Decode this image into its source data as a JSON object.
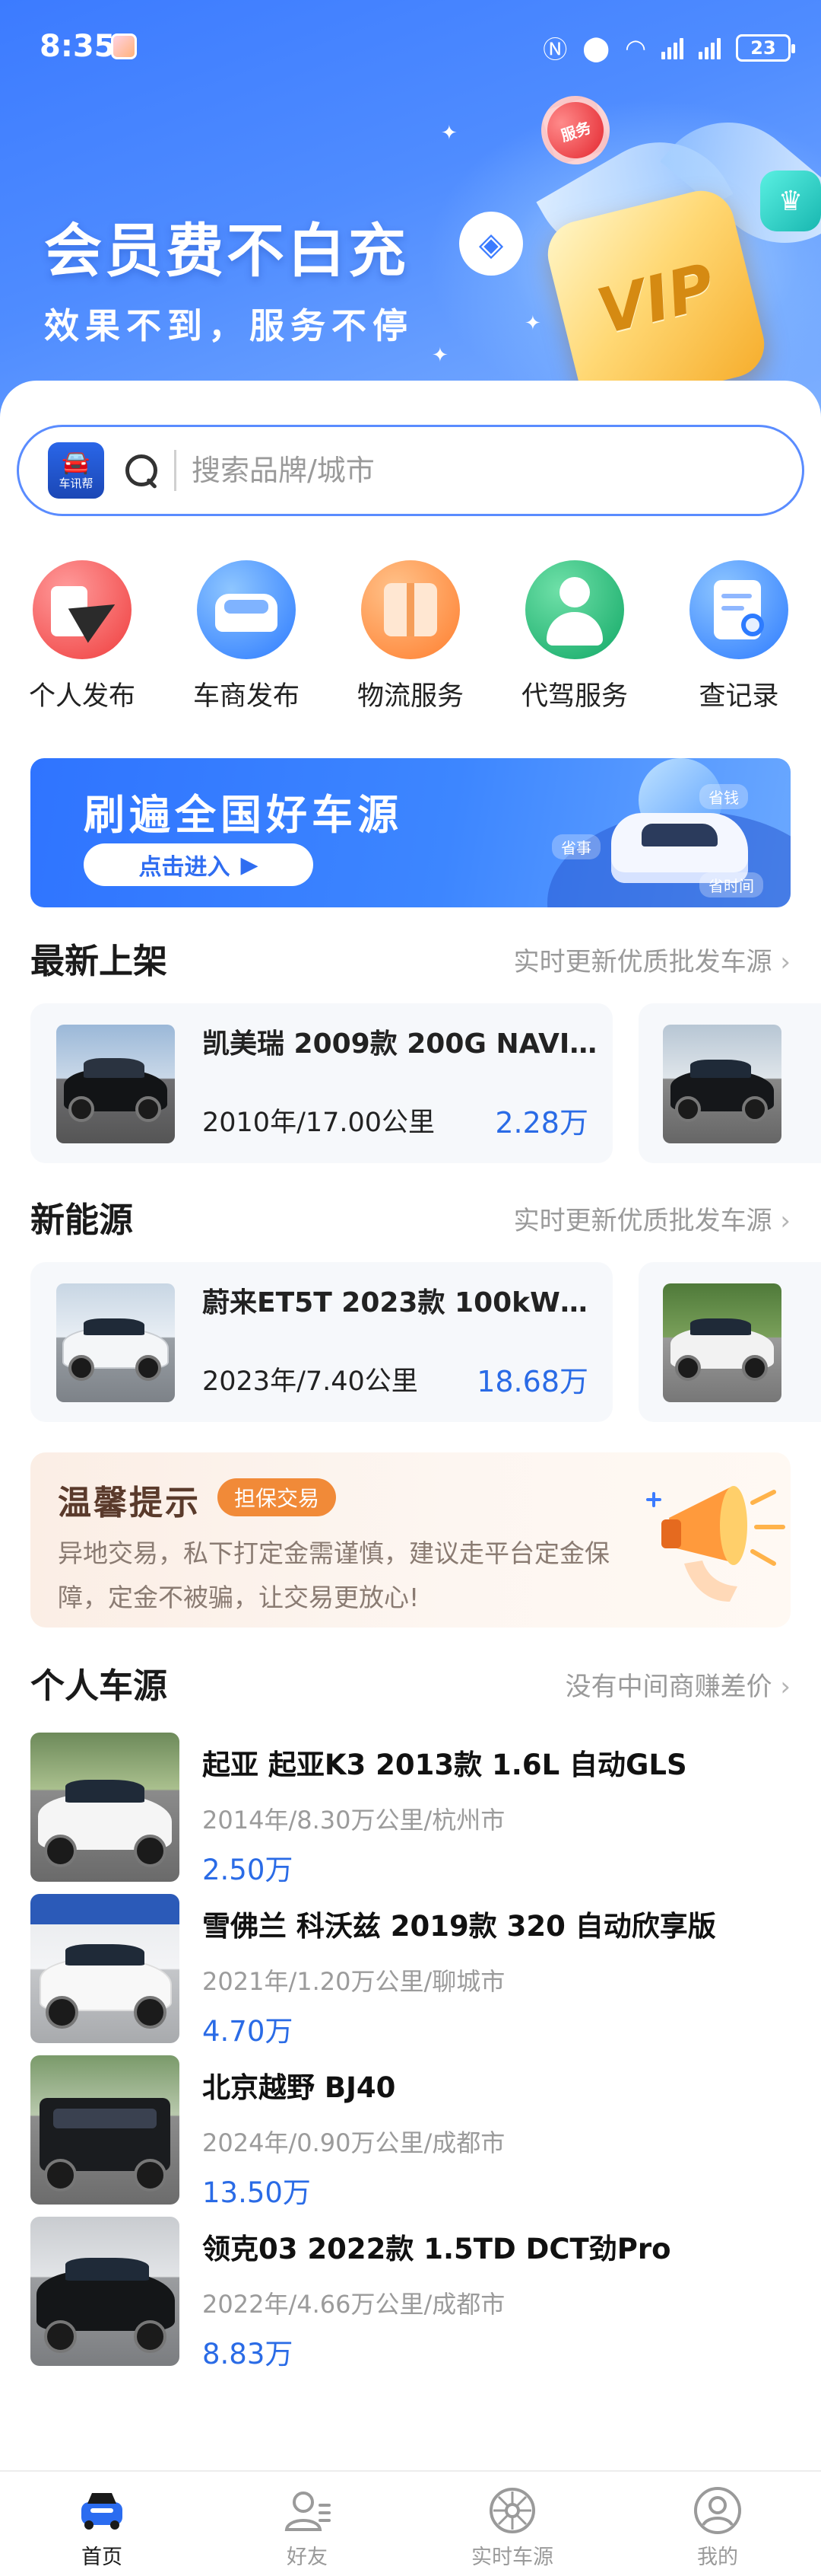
{
  "status_bar": {
    "time": "8:35",
    "battery": "23"
  },
  "hero": {
    "title": "会员费不白充",
    "subtitle": "效果不到，服务不停",
    "badge_text": "VIP",
    "chip_text": "服务"
  },
  "search": {
    "logo_text": "车讯帮",
    "placeholder": "搜索品牌/城市"
  },
  "quick_actions": [
    {
      "label": "个人发布",
      "icon": "paper-plane-icon"
    },
    {
      "label": "车商发布",
      "icon": "car-icon"
    },
    {
      "label": "物流服务",
      "icon": "package-icon"
    },
    {
      "label": "代驾服务",
      "icon": "driver-icon"
    },
    {
      "label": "查记录",
      "icon": "document-search-icon"
    }
  ],
  "banner": {
    "title": "刷遍全国好车源",
    "button": "点击进入",
    "tags": [
      "省钱",
      "省事",
      "省时间"
    ]
  },
  "latest": {
    "title": "最新上架",
    "more": "实时更新优质批发车源",
    "cards": [
      {
        "title": "凯美瑞 2009款 200G NAVI…",
        "info": "2010年/17.00公里",
        "price": "2.28万"
      }
    ]
  },
  "new_energy": {
    "title": "新能源",
    "more": "实时更新优质批发车源",
    "cards": [
      {
        "title": "蔚来ET5T 2023款 100kW…",
        "info": "2023年/7.40公里",
        "price": "18.68万"
      }
    ]
  },
  "notice": {
    "title": "温馨提示",
    "tag": "担保交易",
    "text": "异地交易，私下打定金需谨慎，建议走平台定金保障，定金不被骗，让交易更放心!"
  },
  "personal": {
    "title": "个人车源",
    "more": "没有中间商赚差价",
    "items": [
      {
        "title": "起亚  起亚K3 2013款 1.6L 自动GLS",
        "info": "2014年/8.30万公里/杭州市",
        "price": "2.50万"
      },
      {
        "title": "雪佛兰  科沃兹 2019款 320 自动欣享版",
        "info": "2021年/1.20万公里/聊城市",
        "price": "4.70万"
      },
      {
        "title": "北京越野  BJ40",
        "info": "2024年/0.90万公里/成都市",
        "price": "13.50万"
      },
      {
        "title": "领克03  2022款 1.5TD DCT劲Pro",
        "info": "2022年/4.66万公里/成都市",
        "price": "8.83万"
      }
    ]
  },
  "tabbar": [
    {
      "label": "首页",
      "icon": "home-car-icon",
      "active": true
    },
    {
      "label": "好友",
      "icon": "friends-icon",
      "active": false
    },
    {
      "label": "实时车源",
      "icon": "wheel-icon",
      "active": false
    },
    {
      "label": "我的",
      "icon": "profile-icon",
      "active": false
    }
  ],
  "colors": {
    "brand_blue": "#3c7bff",
    "price_blue": "#2a6be6",
    "notice_orange": "#f18a38"
  }
}
